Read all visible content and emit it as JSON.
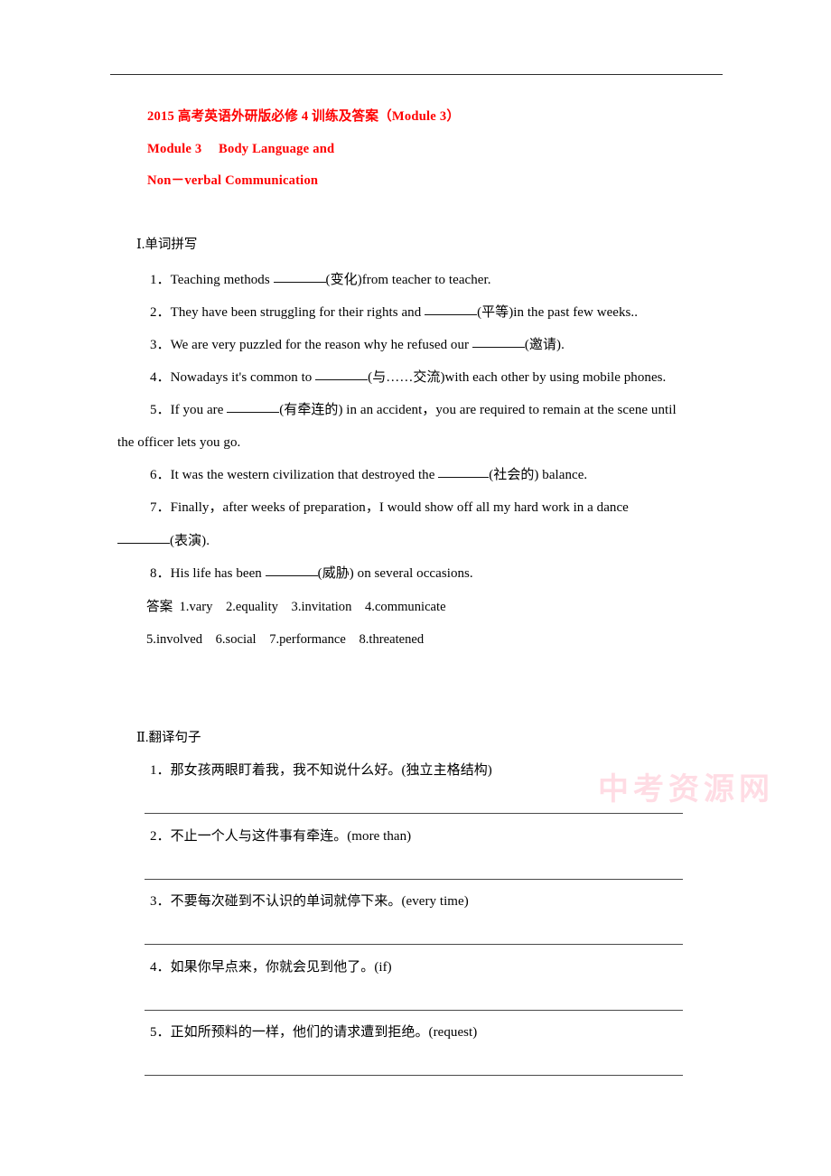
{
  "document": {
    "title_lines": [
      "2015 高考英语外研版必修 4 训练及答案（Module 3）",
      "Module 3　 Body Language and",
      "Non－verbal Communication"
    ],
    "title_color": "#FF0000",
    "watermark": "中考资源网"
  },
  "section_one": {
    "heading": "Ⅰ.单词拼写",
    "questions": [
      {
        "number": "1．",
        "before_blank": "Teaching methods ",
        "after_blank": "(变化)from teacher to teacher."
      },
      {
        "number": "2．",
        "before_blank": "They have been struggling for their rights and ",
        "after_blank": "(平等)in the past few weeks.."
      },
      {
        "number": "3．",
        "before_blank": "We are very puzzled for the reason why he refused our ",
        "after_blank": "(邀请)."
      },
      {
        "number": "4．",
        "before_blank": "Nowadays it's common to ",
        "after_blank": "(与……交流)with each other by using mobile phones."
      },
      {
        "number": "5．",
        "before_blank": "If you are ",
        "after_blank": "(有牵连的) in an accident，you are required to remain at the scene until",
        "wrap_line": "the officer lets you go."
      },
      {
        "number": "6．",
        "before_blank": "It was the western civilization that destroyed the ",
        "after_blank": "(社会的) balance."
      },
      {
        "number": "7．",
        "before_blank": "Finally，after weeks of preparation，I would show off all my hard work in a dance",
        "after_blank": "",
        "wrap_blank_suffix": "(表演)."
      },
      {
        "number": "8．",
        "before_blank": "His life has been ",
        "after_blank": "(威胁) on several occasions."
      }
    ],
    "answer_label": "答案",
    "answers_row_1": "1.vary　2.equality　3.invitation　4.communicate",
    "answers_row_2": "5.involved　6.social　7.performance　8.threatened"
  },
  "section_two": {
    "heading": "Ⅱ.翻译句子",
    "questions": [
      {
        "number": "1．",
        "text": "那女孩两眼盯着我，我不知说什么好。(独立主格结构)"
      },
      {
        "number": "2．",
        "text": "不止一个人与这件事有牵连。(more than)"
      },
      {
        "number": "3．",
        "text": "不要每次碰到不认识的单词就停下来。(every time)"
      },
      {
        "number": "4．",
        "text": "如果你早点来，你就会见到他了。(if)"
      },
      {
        "number": "5．",
        "text": "正如所预料的一样，他们的请求遭到拒绝。(request)"
      }
    ]
  }
}
